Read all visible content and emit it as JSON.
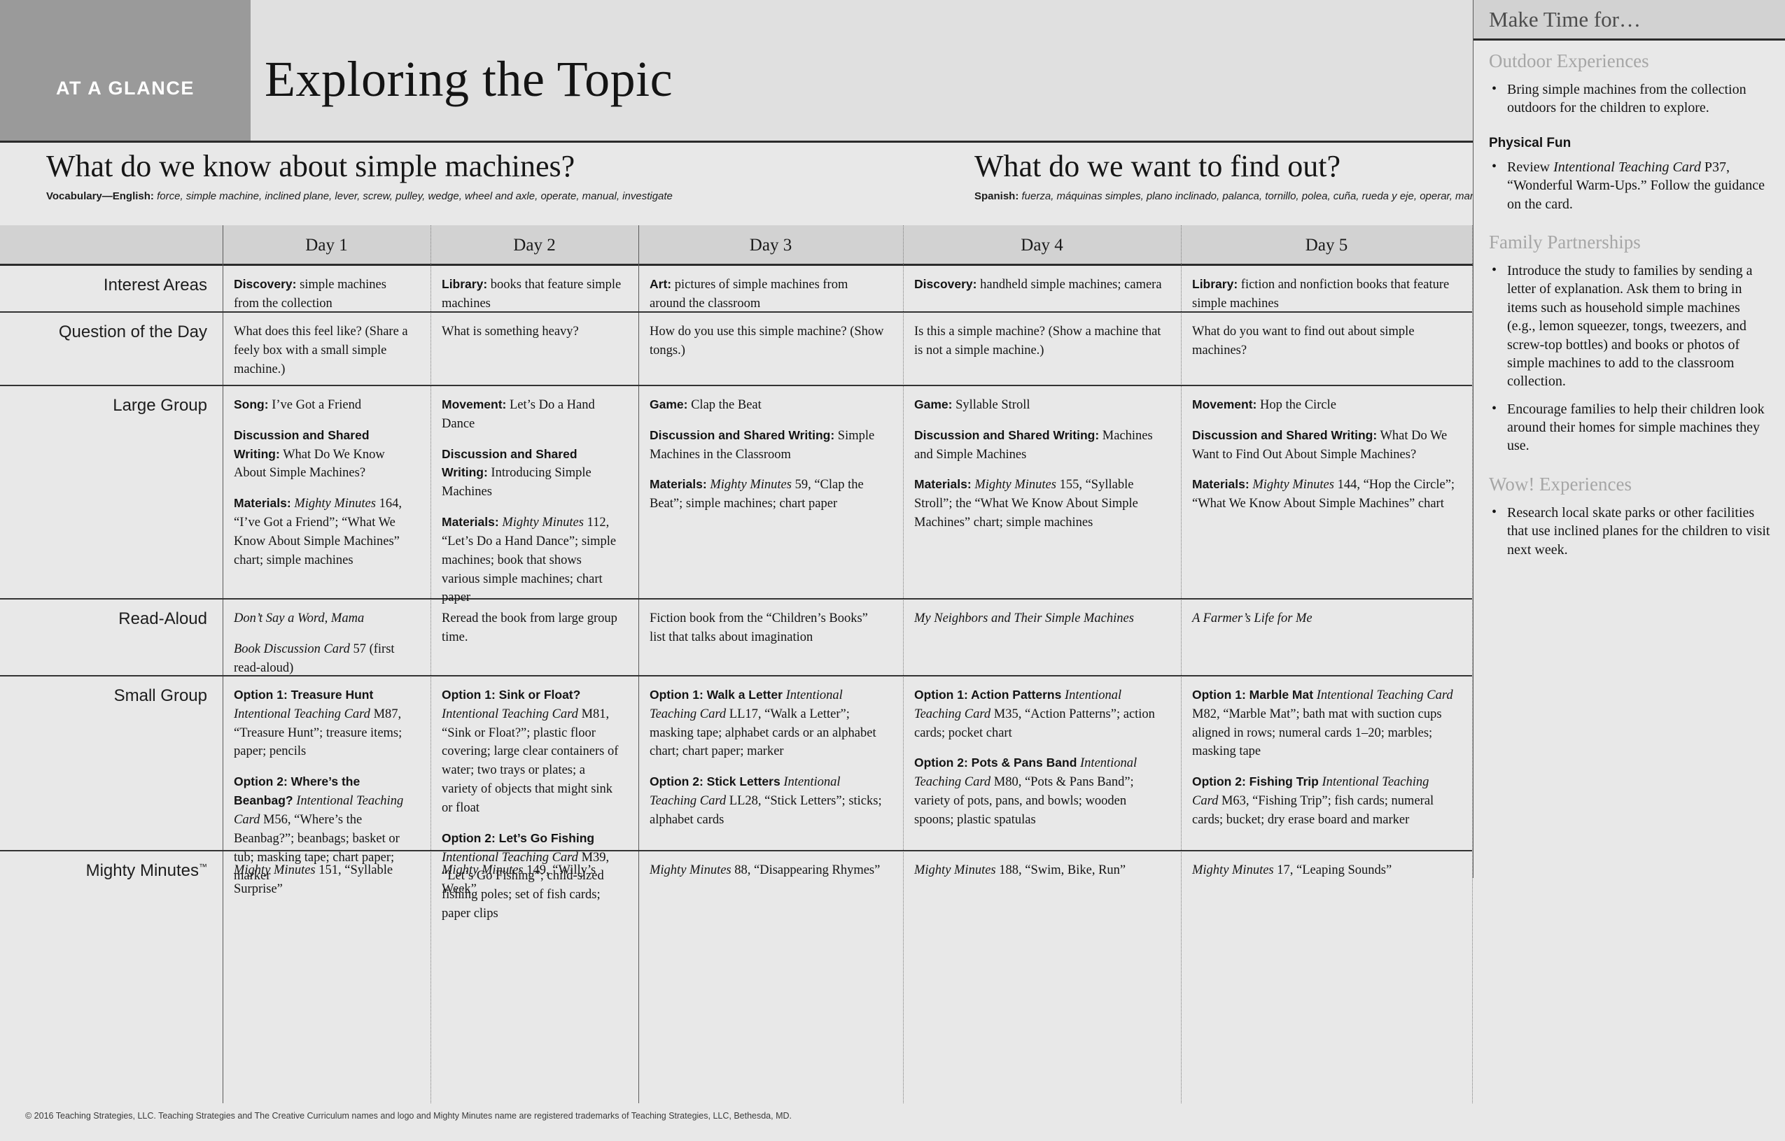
{
  "header": {
    "badge": "AT A GLANCE",
    "title": "Exploring the Topic"
  },
  "questions": {
    "left_title": "What do we know about simple machines?",
    "left_vocab_label": "Vocabulary—English:",
    "left_vocab_terms": "force, simple machine, inclined plane, lever, screw, pulley, wedge, wheel and axle, operate, manual, investigate",
    "right_title": "What do we want to find out?",
    "right_vocab_label": "Spanish:",
    "right_vocab_terms": "fuerza, máquinas simples, plano inclinado, palanca, tornillo, polea, cuña, rueda y eje, operar, manual, investigar"
  },
  "columns": {
    "row_label_header": "",
    "days": [
      "Day 1",
      "Day 2",
      "Day 3",
      "Day 4",
      "Day 5"
    ],
    "make_time": "Make Time for…"
  },
  "rows": [
    {
      "label": "Interest Areas",
      "label_sup": "",
      "cells": [
        [
          {
            "t": "Discovery:",
            "b": true
          },
          {
            "t": " simple machines from the collection"
          }
        ],
        [
          {
            "t": "Library:",
            "b": true
          },
          {
            "t": " books that feature simple machines"
          }
        ],
        [
          {
            "t": "Art:",
            "b": true
          },
          {
            "t": " pictures of simple machines from around the classroom"
          }
        ],
        [
          {
            "t": "Discovery:",
            "b": true
          },
          {
            "t": " handheld simple machines; camera"
          }
        ],
        [
          {
            "t": "Library:",
            "b": true
          },
          {
            "t": " fiction and nonfiction books that feature simple machines"
          }
        ]
      ]
    },
    {
      "label": "Question of the Day",
      "label_sup": "",
      "cells": [
        [
          {
            "t": "What does this feel like? (Share a feely box with a small simple machine.)"
          }
        ],
        [
          {
            "t": "What is something heavy?"
          }
        ],
        [
          {
            "t": "How do you use this simple machine? (Show tongs.)"
          }
        ],
        [
          {
            "t": "Is this a simple machine? (Show a machine that is not a simple machine.)"
          }
        ],
        [
          {
            "t": "What do you want to find out about simple machines?"
          }
        ]
      ]
    },
    {
      "label": "Large Group",
      "label_sup": "",
      "cells": [
        [
          {
            "t": "Song:",
            "b": true
          },
          {
            "t": " I’ve Got a Friend"
          },
          {
            "gap": true
          },
          {
            "t": "Discussion and Shared Writing:",
            "b": true
          },
          {
            "t": " What Do We Know About Simple Machines?"
          },
          {
            "gap": true
          },
          {
            "t": "Materials:",
            "b": true
          },
          {
            "t": " "
          },
          {
            "t": "Mighty Minutes",
            "i": true
          },
          {
            "t": " 164, “I’ve Got a Friend”; “What We Know About Simple Machines” chart; simple machines"
          }
        ],
        [
          {
            "t": "Movement:",
            "b": true
          },
          {
            "t": " Let’s Do a Hand Dance"
          },
          {
            "gap": true
          },
          {
            "t": "Discussion and Shared Writing:",
            "b": true
          },
          {
            "t": " Introducing Simple Machines"
          },
          {
            "gap": true
          },
          {
            "t": "Materials:",
            "b": true
          },
          {
            "t": " "
          },
          {
            "t": "Mighty Minutes",
            "i": true
          },
          {
            "t": " 112, “Let’s Do a Hand Dance”; simple machines; book that shows various simple machines; chart paper"
          }
        ],
        [
          {
            "t": "Game:",
            "b": true
          },
          {
            "t": " Clap the Beat"
          },
          {
            "gap": true
          },
          {
            "t": "Discussion and Shared Writing:",
            "b": true
          },
          {
            "t": " Simple Machines in the Classroom"
          },
          {
            "gap": true
          },
          {
            "t": "Materials:",
            "b": true
          },
          {
            "t": " "
          },
          {
            "t": "Mighty Minutes",
            "i": true
          },
          {
            "t": " 59, “Clap the Beat”; simple machines; chart paper"
          }
        ],
        [
          {
            "t": "Game:",
            "b": true
          },
          {
            "t": " Syllable Stroll"
          },
          {
            "gap": true
          },
          {
            "t": "Discussion and Shared Writing:",
            "b": true
          },
          {
            "t": " Machines and Simple Machines"
          },
          {
            "gap": true
          },
          {
            "t": "Materials:",
            "b": true
          },
          {
            "t": " "
          },
          {
            "t": "Mighty Minutes",
            "i": true
          },
          {
            "t": " 155, “Syllable Stroll”; the “What We Know About Simple Machines” chart; simple machines"
          }
        ],
        [
          {
            "t": "Movement:",
            "b": true
          },
          {
            "t": " Hop the Circle"
          },
          {
            "gap": true
          },
          {
            "t": "Discussion and Shared Writing:",
            "b": true
          },
          {
            "t": " What Do We Want to Find Out About Simple Machines?"
          },
          {
            "gap": true
          },
          {
            "t": "Materials:",
            "b": true
          },
          {
            "t": " "
          },
          {
            "t": "Mighty Minutes",
            "i": true
          },
          {
            "t": " 144, “Hop the Circle”; “What We Know About Simple Machines” chart"
          }
        ]
      ]
    },
    {
      "label": "Read-Aloud",
      "label_sup": "",
      "cells": [
        [
          {
            "t": "Don’t Say a Word, Mama",
            "i": true
          },
          {
            "gap": true
          },
          {
            "t": "Book Discussion Card",
            "i": true
          },
          {
            "t": " 57 (first read-aloud)"
          }
        ],
        [
          {
            "t": "Reread the book from large group time."
          }
        ],
        [
          {
            "t": "Fiction book from the “Children’s Books” list that talks about imagination"
          }
        ],
        [
          {
            "t": "My Neighbors and Their Simple Machines",
            "i": true
          }
        ],
        [
          {
            "t": "A Farmer’s Life for Me",
            "i": true
          }
        ]
      ]
    },
    {
      "label": "Small Group",
      "label_sup": "",
      "cells": [
        [
          {
            "t": "Option 1: Treasure Hunt",
            "b": true
          },
          {
            "t": "Intentional Teaching Card",
            "i": true
          },
          {
            "t": " M87, “Treasure Hunt”; treasure items; paper; pencils"
          },
          {
            "gap": true
          },
          {
            "t": "Option 2: Where’s the Beanbag?",
            "b": true
          },
          {
            "t": "Intentional Teaching Card",
            "i": true
          },
          {
            "t": " M56, “Where’s the Beanbag?”; beanbags; basket or tub; masking tape; chart paper; marker"
          }
        ],
        [
          {
            "t": "Option 1: Sink or Float?",
            "b": true
          },
          {
            "t": "Intentional Teaching Card",
            "i": true
          },
          {
            "t": " M81, “Sink or Float?”; plastic floor covering; large clear containers of water; two trays or plates; a variety of objects that might sink or float"
          },
          {
            "gap": true
          },
          {
            "t": "Option 2: Let’s Go Fishing",
            "b": true
          },
          {
            "t": "Intentional Teaching Card",
            "i": true
          },
          {
            "t": " M39, “Let’s Go Fishing”; child-sized fishing poles; set of fish cards; paper clips"
          }
        ],
        [
          {
            "t": "Option 1: Walk a Letter",
            "b": true
          },
          {
            "t": "Intentional Teaching Card",
            "i": true
          },
          {
            "t": " LL17, “Walk a Letter”; masking tape; alphabet cards or an alphabet chart; chart paper; marker"
          },
          {
            "gap": true
          },
          {
            "t": "Option 2: Stick Letters",
            "b": true
          },
          {
            "t": "Intentional Teaching Card",
            "i": true
          },
          {
            "t": " LL28, “Stick Letters”; sticks; alphabet cards"
          }
        ],
        [
          {
            "t": "Option 1: Action Patterns",
            "b": true
          },
          {
            "t": "Intentional Teaching Card",
            "i": true
          },
          {
            "t": " M35, “Action Patterns”; action cards; pocket chart"
          },
          {
            "gap": true
          },
          {
            "t": "Option 2: Pots & Pans Band",
            "b": true
          },
          {
            "t": "Intentional Teaching Card",
            "i": true
          },
          {
            "t": " M80, “Pots & Pans Band”; variety of pots, pans, and bowls; wooden spoons; plastic spatulas"
          }
        ],
        [
          {
            "t": "Option 1: Marble Mat",
            "b": true
          },
          {
            "t": "Intentional Teaching Card",
            "i": true
          },
          {
            "t": " M82, “Marble Mat”; bath mat with suction cups aligned in rows; numeral cards 1–20; marbles; masking tape"
          },
          {
            "gap": true
          },
          {
            "t": "Option 2: Fishing Trip",
            "b": true
          },
          {
            "t": "Intentional Teaching Card",
            "i": true
          },
          {
            "t": " M63, “Fishing Trip”; fish cards; numeral cards; bucket; dry erase board and marker"
          }
        ]
      ]
    },
    {
      "label": "Mighty Minutes",
      "label_sup": "™",
      "cells": [
        [
          {
            "t": "Mighty Minutes",
            "i": true
          },
          {
            "t": " 151, “Syllable Surprise”"
          }
        ],
        [
          {
            "t": "Mighty Minutes",
            "i": true
          },
          {
            "t": " 149, “Willy’s Week”"
          }
        ],
        [
          {
            "t": "Mighty Minutes",
            "i": true
          },
          {
            "t": " 88, “Disappearing Rhymes”"
          }
        ],
        [
          {
            "t": "Mighty Minutes",
            "i": true
          },
          {
            "t": " 188, “Swim, Bike, Run”"
          }
        ],
        [
          {
            "t": "Mighty Minutes",
            "i": true
          },
          {
            "t": " 17, “Leaping Sounds”"
          }
        ]
      ]
    }
  ],
  "sidebar": {
    "title": "Make Time for…",
    "sections": [
      {
        "heading": "Outdoor Experiences",
        "heading_style": "gray",
        "items": [
          [
            {
              "t": "Bring simple machines from the collection outdoors for the children to explore."
            }
          ]
        ]
      },
      {
        "heading": "Physical Fun",
        "heading_style": "black",
        "items": [
          [
            {
              "t": "Review "
            },
            {
              "t": "Intentional Teaching Card",
              "i": true
            },
            {
              "t": " P37, “Wonderful Warm-Ups.” Follow the guidance on the card."
            }
          ]
        ]
      },
      {
        "heading": "Family Partnerships",
        "heading_style": "gray",
        "items": [
          [
            {
              "t": "Introduce the study to families by sending a letter of explanation. Ask them to bring in items such as household simple machines (e.g., lemon squeezer, tongs, tweezers, and screw-top bottles) and books or photos of simple machines to add to the classroom collection."
            }
          ],
          [
            {
              "t": "Encourage families to help their children look around their homes for simple machines they use."
            }
          ]
        ]
      },
      {
        "heading": "Wow! Experiences",
        "heading_style": "gray",
        "items": [
          [
            {
              "t": "Research local skate parks or other facilities that use inclined planes for the children to visit next week."
            }
          ]
        ]
      }
    ]
  },
  "footer": {
    "copyright": "© 2016 Teaching Strategies, LLC. Teaching Strategies and The Creative Curriculum names and logo and Mighty Minutes name are registered trademarks of Teaching Strategies, LLC, Bethesda, MD."
  },
  "colors": {
    "badge_bg": "#9a9a9a",
    "header_bg": "#e0e0e0",
    "page_bg": "#e8e8e8",
    "col_head_bg": "#d2d2d2",
    "gray_heading": "#a6a6a6",
    "rule": "#2b2b2b"
  }
}
